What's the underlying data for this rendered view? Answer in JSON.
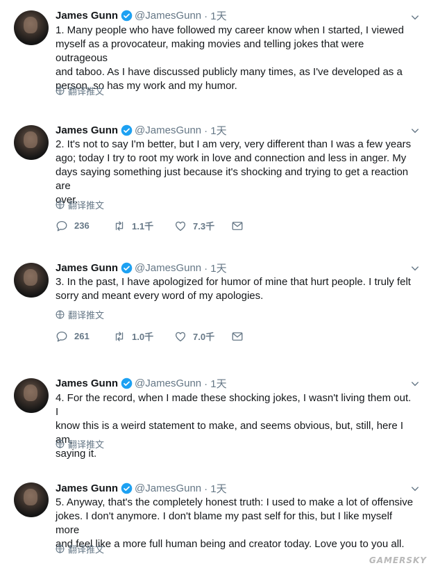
{
  "tweets": [
    {
      "name": "James Gunn",
      "handle": "@JamesGunn",
      "time": "· 1天",
      "text": "1. Many people who have followed my career know when I started, I viewed\nmyself as a provocateur, making movies and telling jokes that were outrageous\nand taboo. As I have discussed publicly many times, as I've developed as a\nperson, so has my work and my humor.",
      "translate": "翻译推文"
    },
    {
      "name": "James Gunn",
      "handle": "@JamesGunn",
      "time": "· 1天",
      "text": "2. It's not to say I'm better, but I am very, very different than I was a few years\nago; today I try to root my work in love and connection and less in anger.  My\ndays saying something just because it's shocking and trying to get a reaction are\nover.",
      "translate": "翻译推文",
      "replies": "236",
      "retweets": "1.1千",
      "likes": "7.3千"
    },
    {
      "name": "James Gunn",
      "handle": "@JamesGunn",
      "time": "· 1天",
      "text": "3. In the past, I have apologized for humor of mine that hurt people. I truly felt\nsorry and meant every word of my apologies.",
      "translate": "翻译推文",
      "replies": "261",
      "retweets": "1.0千",
      "likes": "7.0千"
    },
    {
      "name": "James Gunn",
      "handle": "@JamesGunn",
      "time": "· 1天",
      "text": "4. For the record, when I made these shocking jokes, I wasn't living them out. I\nknow this is a weird statement to make, and seems obvious, but, still, here I am,\nsaying it.",
      "translate": "翻译推文"
    },
    {
      "name": "James Gunn",
      "handle": "@JamesGunn",
      "time": "· 1天",
      "text": "5. Anyway, that's the completely honest truth: I used to make a lot of offensive\njokes. I don't anymore. I don't blame my past self for this, but I like myself more\nand feel like a more full human being and creator today.  Love you to you all.",
      "translate": "翻译推文"
    }
  ],
  "watermark": "GAMERSKY",
  "colors": {
    "verified": "#1da1f2",
    "muted": "#657786",
    "text": "#14171a"
  }
}
